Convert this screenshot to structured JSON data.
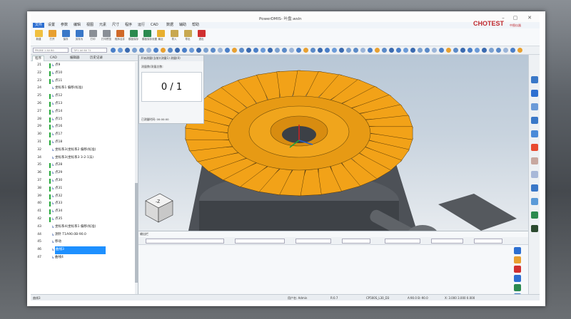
{
  "window": {
    "title": "PowerDMIS- 叶盘.wsln"
  },
  "brand": {
    "logo": "CHOTEST",
    "tag": "中图仪器"
  },
  "menu": [
    "文件",
    "设置",
    "参数",
    "编辑",
    "视图",
    "元素",
    "尺寸",
    "程序",
    "运行",
    "CAD",
    "数据",
    "辅助",
    "帮助"
  ],
  "ribbon": {
    "labels": [
      "新建",
      "打开",
      "保存",
      "另存为",
      "打印",
      "打印预览",
      "程序合并",
      "模板保存",
      "模板保存设置",
      "最近",
      "导入",
      "导出",
      "退出"
    ],
    "colors": [
      "#f0c040",
      "#e8a030",
      "#3a78c8",
      "#3a78c8",
      "#8a8f96",
      "#8a8f96",
      "#d06a2a",
      "#2b8a4f",
      "#2b8a4f",
      "#e8b030",
      "#c8a850",
      "#c8a850",
      "#d03030"
    ]
  },
  "toolbar": {
    "select1_placeholder": "PROBE 1 A0 B0",
    "select2_placeholder": "TIP1 A0 B0 T1"
  },
  "left_panel": {
    "tabs": [
      "程序",
      "CAD",
      "编辑器",
      "历史记录"
    ],
    "rows": [
      {
        "num": "21",
        "text": "点9",
        "bar": true
      },
      {
        "num": "22",
        "text": "点10",
        "bar": true
      },
      {
        "num": "23",
        "text": "点11",
        "bar": true
      },
      {
        "num": "24",
        "text": "坐标系1 偏移(标准)",
        "bar": false
      },
      {
        "num": "25",
        "text": "点12",
        "bar": true
      },
      {
        "num": "26",
        "text": "点13",
        "bar": true
      },
      {
        "num": "27",
        "text": "点14",
        "bar": true
      },
      {
        "num": "28",
        "text": "点15",
        "bar": true
      },
      {
        "num": "29",
        "text": "点16",
        "bar": true
      },
      {
        "num": "30",
        "text": "点17",
        "bar": true
      },
      {
        "num": "31",
        "text": "点18",
        "bar": true
      },
      {
        "num": "32",
        "text": "坐标系3(坐标系2 偏移(标准)",
        "bar": false
      },
      {
        "num": "34",
        "text": "坐标系3(坐标系3 3-2-1法)",
        "bar": false
      },
      {
        "num": "35",
        "text": "点28",
        "bar": true
      },
      {
        "num": "36",
        "text": "点29",
        "bar": true
      },
      {
        "num": "37",
        "text": "点30",
        "bar": true
      },
      {
        "num": "38",
        "text": "点31",
        "bar": true
      },
      {
        "num": "39",
        "text": "点32",
        "bar": true
      },
      {
        "num": "40",
        "text": "点33",
        "bar": true
      },
      {
        "num": "41",
        "text": "点34",
        "bar": true
      },
      {
        "num": "42",
        "text": "点35",
        "bar": true
      },
      {
        "num": "43",
        "text": "坐标系4(坐标系1 偏移(标准)",
        "bar": false
      },
      {
        "num": "44",
        "text": "测针 T1A90.0B-90.0",
        "bar": false
      },
      {
        "num": "45",
        "text": "移动",
        "bar": false
      },
      {
        "num": "46",
        "text": "曲线3",
        "bar": false,
        "selected": true
      },
      {
        "num": "47",
        "text": "曲线4",
        "bar": false
      }
    ]
  },
  "progress": {
    "title": "开始测量(当前)(测量1) 测量(0)",
    "label": "测量数/测量总数:",
    "count": "0 / 1",
    "time": "已测量时间: 00:00:00"
  },
  "bottom": {
    "title": "输出栏"
  },
  "status": {
    "left": "曲线3",
    "user": "用户名: Admin",
    "probe_d": "R:0.7",
    "probe": "CP500S_L30_D3",
    "angles": "A:90.0  B:-90.0",
    "xyz": "X: 3.000  3.000  0.000"
  },
  "view": {
    "cube_label": "-Z"
  },
  "colors": {
    "blade": "#f2a218",
    "accent": "#2d6fd1",
    "selected": "#1e90ff",
    "bar": "#27a83a"
  }
}
